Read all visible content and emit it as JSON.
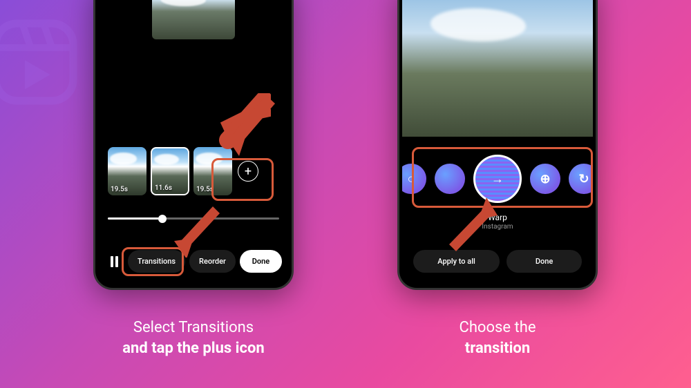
{
  "background_logo": "reels-logo-watermark",
  "phone1": {
    "clips": [
      {
        "duration": "19.5s",
        "selected": false
      },
      {
        "duration": "11.6s",
        "selected": true
      },
      {
        "duration": "19.5s",
        "selected": false
      }
    ],
    "add_icon_label": "+",
    "pause_icon": "pause-icon",
    "transitions_label": "Transitions",
    "reorder_label": "Reorder",
    "done_label": "Done"
  },
  "phone2": {
    "transition_options": [
      {
        "name": "circle-out",
        "symbol": "○"
      },
      {
        "name": "blur",
        "symbol": ""
      },
      {
        "name": "warp",
        "symbol": "→",
        "center": true
      },
      {
        "name": "zoom",
        "symbol": "⊕"
      },
      {
        "name": "spin",
        "symbol": "↻"
      }
    ],
    "selected_name": "Warp",
    "selected_sub": "Instagram",
    "apply_label": "Apply to all",
    "done_label": "Done"
  },
  "captions": {
    "left_line1": "Select Transitions",
    "left_line2": "and tap the plus icon",
    "right_line1": "Choose the",
    "right_line2": "transition"
  },
  "colors": {
    "highlight": "#d85a3a",
    "arrow": "#c74833"
  }
}
